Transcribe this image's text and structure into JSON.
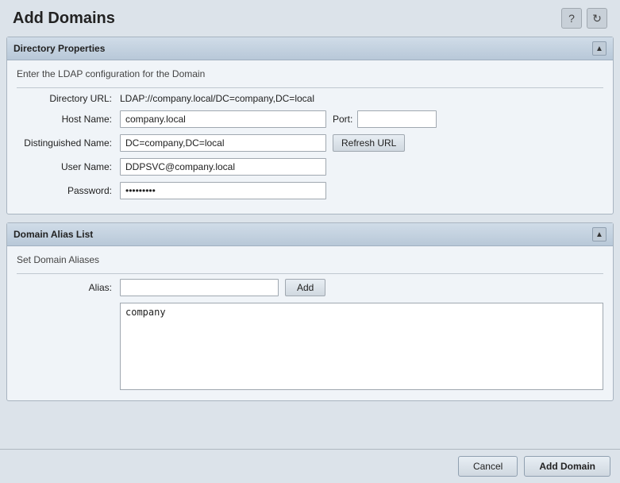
{
  "header": {
    "title": "Add Domains",
    "help_icon": "?",
    "refresh_icon": "↻"
  },
  "directory_panel": {
    "title": "Directory Properties",
    "description": "Enter the LDAP configuration for the Domain",
    "fields": {
      "directory_url_label": "Directory URL:",
      "directory_url_value": "LDAP://company.local/DC=company,DC=local",
      "host_name_label": "Host Name:",
      "host_name_value": "company.local",
      "port_label": "Port:",
      "port_value": "",
      "distinguished_name_label": "Distinguished Name:",
      "distinguished_name_value": "DC=company,DC=local",
      "refresh_url_label": "Refresh URL",
      "user_name_label": "User Name:",
      "user_name_value": "DDPSVC@company.local",
      "password_label": "Password:",
      "password_value": "••••••••"
    }
  },
  "alias_panel": {
    "title": "Domain Alias List",
    "description": "Set Domain Aliases",
    "alias_label": "Alias:",
    "alias_value": "",
    "alias_placeholder": "",
    "add_button_label": "Add",
    "alias_list": "company"
  },
  "footer": {
    "cancel_label": "Cancel",
    "add_domain_label": "Add Domain"
  }
}
